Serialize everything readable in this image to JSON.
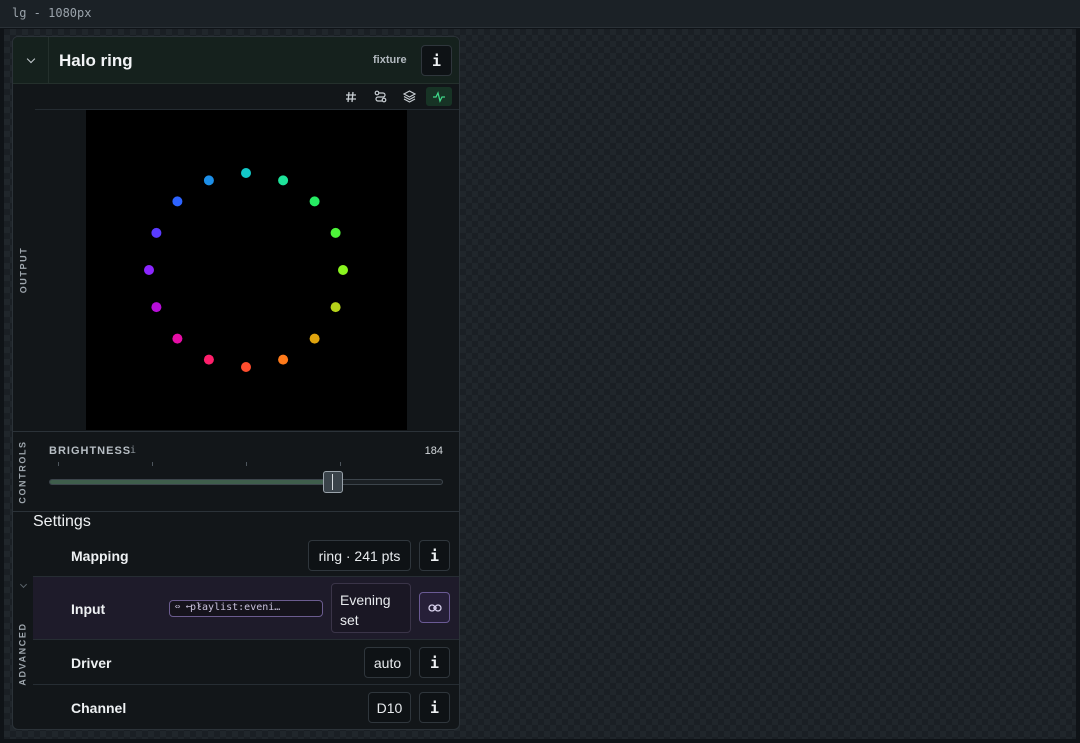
{
  "window": {
    "title": "lg - 1080px"
  },
  "panel": {
    "title": "Halo ring",
    "tag": "fixture",
    "info_label": "i"
  },
  "output": {
    "label": "OUTPUT",
    "toolbar": [
      {
        "icon": "hash-icon",
        "active": false
      },
      {
        "icon": "route-icon",
        "active": false
      },
      {
        "icon": "layers-icon",
        "active": false
      },
      {
        "icon": "activity-icon",
        "active": true
      }
    ],
    "ring_colors": [
      "#ff4d2e",
      "#ff7a1a",
      "#e0a40e",
      "#b7d31a",
      "#8af51f",
      "#4df53a",
      "#26ec63",
      "#1ee39a",
      "#13c9c9",
      "#1d8fe8",
      "#2d63ff",
      "#5a3bff",
      "#8c26ff",
      "#b80fd8",
      "#e60ea6",
      "#ff1f6b"
    ]
  },
  "controls": {
    "label": "CONTROLS",
    "brightness": {
      "label": "BRIGHTNESS",
      "info": "i",
      "value": "184",
      "level": 184,
      "max": 255
    }
  },
  "settings": {
    "title": "Settings",
    "advanced_label": "ADVANCED",
    "rows": {
      "mapping": {
        "label": "Mapping",
        "value": "ring · 241 pts",
        "info": "i"
      },
      "input": {
        "label": "Input",
        "chip": "playlist:eveni…",
        "value": "Evening set"
      },
      "driver": {
        "label": "Driver",
        "value": "auto",
        "info": "i"
      },
      "channel": {
        "label": "Channel",
        "value": "D10",
        "info": "i"
      }
    }
  }
}
